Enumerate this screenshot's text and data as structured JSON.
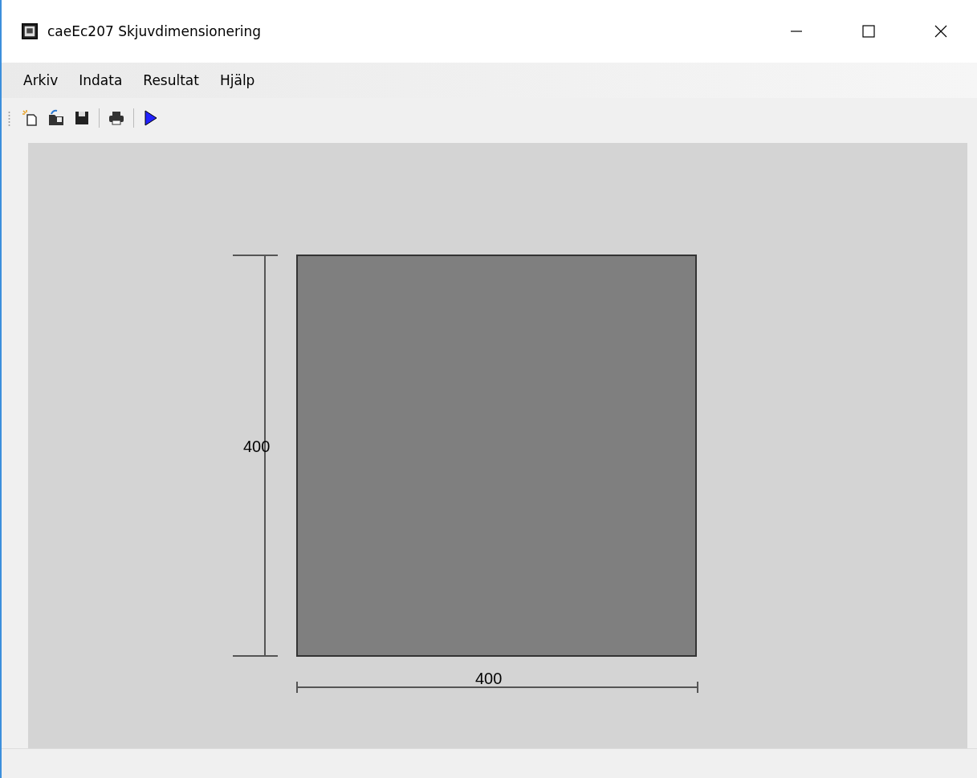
{
  "window": {
    "title": "caeEc207 Skjuvdimensionering"
  },
  "menu": [
    "Arkiv",
    "Indata",
    "Resultat",
    "Hjälp"
  ],
  "drawing": {
    "height_label": "400",
    "width_label": "400"
  }
}
